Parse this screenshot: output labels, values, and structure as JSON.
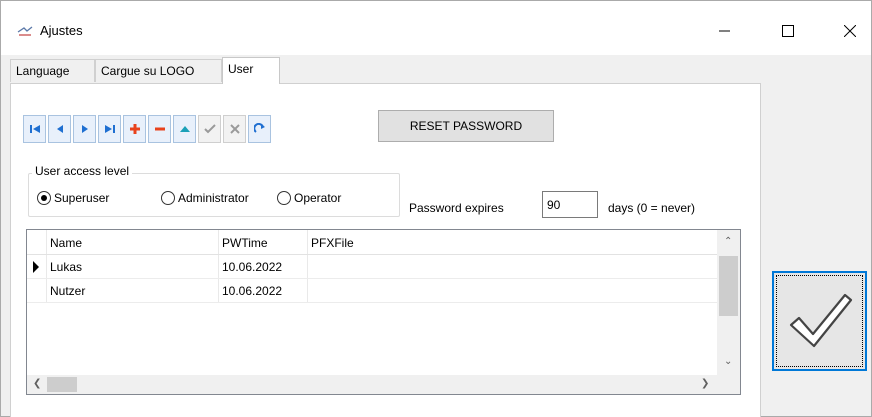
{
  "window": {
    "title": "Ajustes"
  },
  "tabs": [
    {
      "label": "Language"
    },
    {
      "label": "Cargue su LOGO"
    },
    {
      "label": "User"
    }
  ],
  "toolbar": {
    "buttons": [
      "first-record-icon",
      "prior-record-icon",
      "next-record-icon",
      "last-record-icon",
      "insert-record-icon",
      "delete-record-icon",
      "edit-record-icon",
      "post-edit-icon",
      "cancel-edit-icon",
      "refresh-data-icon"
    ],
    "reset_password_label": "RESET PASSWORD"
  },
  "access_level": {
    "title": "User access level",
    "options": [
      {
        "label": "Superuser",
        "selected": true
      },
      {
        "label": "Administrator",
        "selected": false
      },
      {
        "label": "Operator",
        "selected": false
      }
    ]
  },
  "password": {
    "label": "Password expires",
    "value": "90",
    "suffix": "days (0 = never)"
  },
  "grid": {
    "columns": [
      "Name",
      "PWTime",
      "PFXFile"
    ],
    "rows": [
      {
        "name": "Lukas",
        "pwtime": "10.06.2022",
        "pfxfile": ""
      },
      {
        "name": "Nutzer",
        "pwtime": "10.06.2022",
        "pfxfile": ""
      }
    ],
    "current_row": 0
  },
  "colors": {
    "accent": "#0078d7",
    "nav_blue": "#1f6fd1",
    "nav_red": "#e8421c"
  }
}
